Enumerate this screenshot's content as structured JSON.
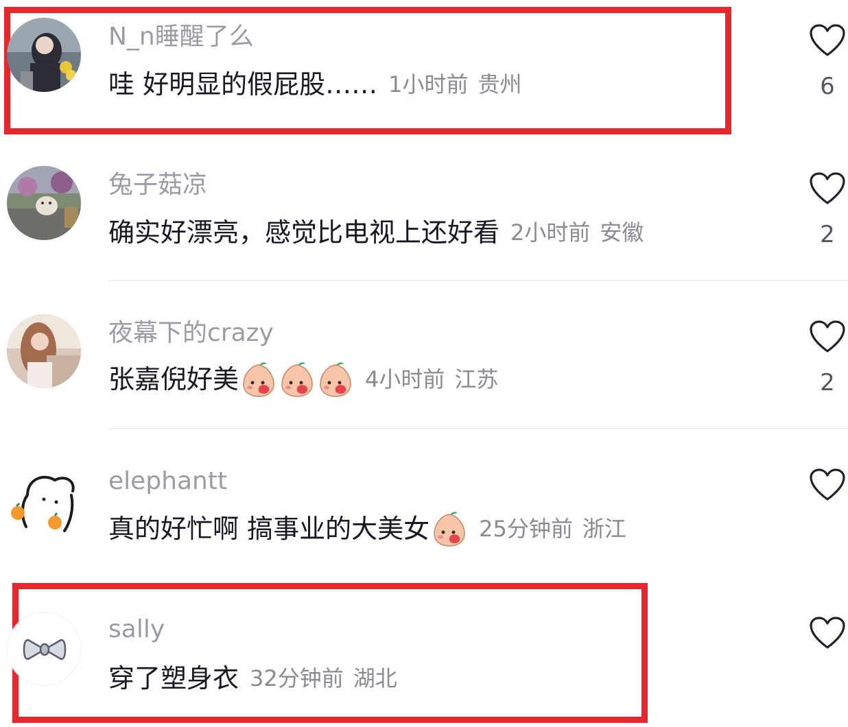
{
  "comments": [
    {
      "username": "N_n睡醒了么",
      "text": "哇  好明显的假屁股……",
      "time": "1小时前",
      "location": "贵州",
      "likes": "6",
      "highlighted": true
    },
    {
      "username": "兔子菇凉",
      "text": "确实好漂亮，感觉比电视上还好看",
      "time": "2小时前",
      "location": "安徽",
      "likes": "2",
      "highlighted": false
    },
    {
      "username": "夜幕下的crazy",
      "text": "张嘉倪好美",
      "emoji_count": 3,
      "emoji_icon": "blushing-peach-emoji",
      "time": "4小时前",
      "location": "江苏",
      "likes": "2",
      "highlighted": false
    },
    {
      "username": "elephantt",
      "text": "真的好忙啊 搞事业的大美女",
      "emoji_count": 1,
      "emoji_icon": "blushing-peach-emoji",
      "time": "25分钟前",
      "location": "浙江",
      "likes": "",
      "highlighted": false
    },
    {
      "username": "sally",
      "text": "穿了塑身衣",
      "time": "32分钟前",
      "location": "湖北",
      "likes": "",
      "highlighted": true
    }
  ],
  "colors": {
    "highlight_border": "#e9262b",
    "username": "#9a9ba3",
    "meta": "#8a8b91",
    "text": "#161823"
  },
  "icons": {
    "like": "heart-outline-icon"
  }
}
